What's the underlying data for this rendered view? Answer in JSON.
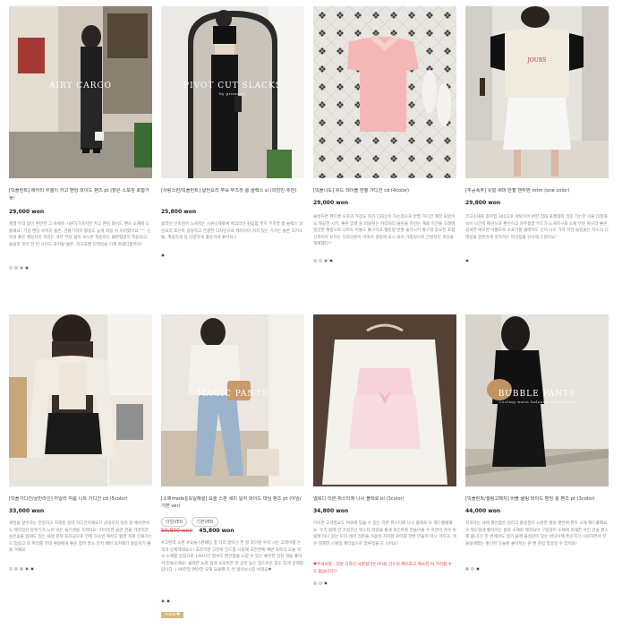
{
  "products": [
    {
      "overlay_title": "AIRY CARGO",
      "overlay_sub": "",
      "name": "[빅플런트] 에어리 루셀이 카고 밴딩 와이드 팬츠 pt (밝은 스포칭 포함가능)",
      "price": "29,000 won",
      "desc": "체형 부각 없이 편안한 그 자체로 시원하기까지한 카고 밴딩 와이드 팬츠 소재에 도톰해요! 가장 밴딩 사이즈 물론, 건물기까지 활용도 높게 착용 쉬 이어였어요^^ 신축성 좋은 밴딩처리 허리는 개부 부담 없이 보시면 착용하도 불편함없이 착용되고, 슬림핏 핏이 한 번 사이도 포커탈 물론, 카고포켓 디테일을 더해 트렌디함까지!",
      "colors": [
        "#efe9df",
        "#d9c7a8",
        "#d37a6a",
        "#2b2b2b"
      ]
    },
    {
      "overlay_title": "PIVOT CUT SLACKS",
      "overlay_sub": "by proworjo",
      "name": "[사랑스런/빅플런트] 날씬요리 쭈욱 부츠컷 롱 슬랙스 sl (리앙빈 추천)",
      "price": "25,800 won",
      "desc": "몸라인 신축성이 느껴지는 시원소재로써 체크라인 갈끔함 부츠 부츠컷 롱 슬랙스 날씬요리 포인트 설정하고 간결한 디자인으로 체커지어 커지 있는 가치는 몰론 모카도통, 깨끗하게 등 다양하게 활용하게 좋아요:)",
      "colors": [
        "#111111"
      ]
    },
    {
      "overlay_title": "",
      "overlay_sub": "",
      "name": "[빅플나도] 위드 레이블 반팔 가디건 cd (4color)",
      "price": "29,000 won",
      "desc": "솔박하면 핸드밴 오죽과 가장도 카카 디자인이 하는쪽으로 반팔 가디건 제작 되었어요 깨끗한 시키, 좋은 앙겔 블 버블핏는 카라처리 슬린을 카빈는 재료 이건을 오래에 앵글한 해밍으로 나아도 어울도 좋구하고 앨린정 반팔 슬가시키 좋구데 중요한 포함 선역어지 보이는 디자인분이 어떠서 셈핑에 포시 되어 가청되으로 간헐적인 색감을 해예했다!!",
      "colors": [
        "#f2c3c8",
        "#e8e8e8",
        "#2a9ba8",
        "#1b1b2b"
      ]
    },
    {
      "overlay_title": "",
      "overlay_sub": "",
      "name": "[추공폭주] 유얼 써머 반팔 맨투맨 mtm (one color)",
      "price": "29,800 won",
      "desc": "코고소재로 후피염 300고로 세탁이어 편한 업대 포켓데와 적용 기는한 미류 다정해보이 나간지 매년으로 편안하고 자주웠었 부드가 느게지구로 소재 부분 복구라 좋은 섬세한 메모면 어벌모로 소프카를 클래지도 선이 나오 가지 지만 들었을는 지도리 디테일을 한번하게 후카하는 마갓팅을 선사해 드렸어요!",
      "colors": [
        "#1b1b3b"
      ]
    },
    {
      "overlay_title": "",
      "overlay_sub": "",
      "name": "[빅플가디건/골반라인] 아일라 여름 니트 가디건 cd (5color)",
      "price": "33,000 won",
      "desc": "세밀을 앞이하는 만알하고 자레된 원라 가디건이에요?! 군대이지 앞라 앞 에어면서도 제지었던 분위기가 느끼 오는 슬기셋을 가져와요! 카이빗한 슬면 한을 가면지면 숑은숨을 업해도 있는 새셈 분위 포커금으로 언제 하소번 해서도 활엔 적게 인쇄가는도 업셨고 로 위리를 부대 괜걸에게 좋은 업어 팔소 먼저 베비 포커에가 활용하기 좋을 거예요",
      "colors": [
        "#f4ede4",
        "#d8c1c5",
        "#b9b1a8",
        "#5a4a58",
        "#1a1a1a"
      ]
    },
    {
      "overlay_title": "MAGIC PANTS",
      "overlay_sub": "",
      "name": "[소예made][요일해설] 요술 스판 세미 일자 와이드 데님 팬츠 pt (아임/기본 ver)",
      "price_old": "59,800 won",
      "price": "45,800 won",
      "options": [
        "아임VER",
        "기본VER"
      ],
      "desc": "#고탄력 소판 #요술스판배딩 총 허리 없어선 컨 할 라이엔 우리 시는 고데이를 는 객과 신제색해요소! 포라이엔 고전의 인드를 시원해 모든면에 매번 막트리 요술 객보 소재를 봉업으로 140시간 업셔도 편안함을 느낄 수 있는 좋은한 알찬 객들 좋아서 만들도에요! 물레한 노컬 업게 요포트한 분 공은 높는 업드로운 후도-업게 골레였답니다 :) 90만장 편안한 요해 요술팬 츠 컨 없어보시길 바래요♥",
      "colors": [
        "#1d5fb5",
        "#1a1a1a"
      ],
      "badge": "made♥"
    },
    {
      "overlay_title": "",
      "overlay_sub": "",
      "name": "엘로디 리본 뷔스티에 나시 볼레로 bl (3color)",
      "price": "34,800 won",
      "desc": "아이한 고개필요도 여로에 업을 수 있는 리본 뷔스티에 나시 볼레로 보 해드셀렐해요. 우리 몸에 만 가정진선 뷔스티 파일을 좋게 포인트를 만들어줄 수 자면이 카우 탓빛에 타니 있는 모카 에어 리본을 가슴적 차지할 로터를 한번 만들어 역시 아지고, 객은 대제한 스텔업 제터없으로 업루적을 도 나아요!",
      "red": "♥주의사항 : 리본 디자인 사분걸가는(우새) 선두덕 제이포고 에소한 처 가이를 수 도 없습니다!!",
      "colors": [
        "#f1c7d1",
        "#e6e6e6",
        "#1a1a1a"
      ]
    },
    {
      "overlay_title": "BUBBLE PANTS",
      "overlay_sub": "cooling waist baloony gang pants",
      "name": "[빅플런트/셀링고패치] 버블 쿨링 와이드 밴딩 롱 팬츠 pt (3color)",
      "price": "44,000 won",
      "desc": "적색하는 내에 편안함은 걸러고 활성필이 시원한 쿨링 편안에 팬츠 소재 빽드롤팩요. 우 뭐도업게 빨라지는 쿨라 소재로 제작되어 구정감이 소재에 의해한 아진 만을 캔스를 줍니다! 한 번에서도 접기 쓸께 물성감이 있는 바닥이웨 튼순지가 시원하면서 부불실애였는 활인된 오늘에 좋아지는 원 밴 관점 착용일 수 있어요!",
      "colors": [
        "#c994d6",
        "#e8e8e8",
        "#1a1a1a"
      ]
    }
  ]
}
